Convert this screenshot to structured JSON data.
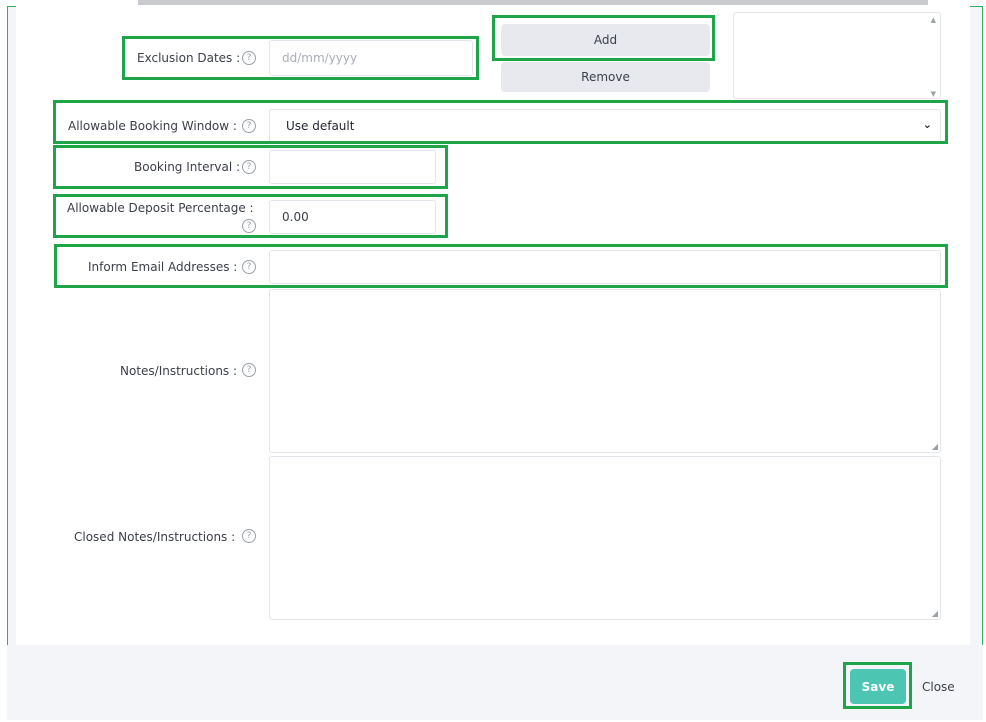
{
  "form": {
    "exclusion_dates": {
      "label": "Exclusion Dates :",
      "placeholder": "dd/mm/yyyy"
    },
    "add_label": "Add",
    "remove_label": "Remove",
    "booking_window": {
      "label": "Allowable Booking Window :",
      "value": "Use default"
    },
    "booking_interval": {
      "label": "Booking Interval :",
      "value": ""
    },
    "deposit_percentage": {
      "label": "Allowable Deposit Percentage :",
      "value": "0.00"
    },
    "inform_emails": {
      "label": "Inform Email Addresses :",
      "value": ""
    },
    "notes": {
      "label": "Notes/Instructions :"
    },
    "closed_notes": {
      "label": "Closed Notes/Instructions :"
    },
    "help_glyph": "?",
    "chevron_glyph": "⌄",
    "scroll_up_glyph": "▲",
    "scroll_down_glyph": "▼",
    "resize_glyph": "◢"
  },
  "footer": {
    "save_label": "Save",
    "close_label": "Close"
  },
  "colors": {
    "highlight": "#1ea54a",
    "save_button": "#4cc6b3",
    "frame": "#2fb257"
  }
}
